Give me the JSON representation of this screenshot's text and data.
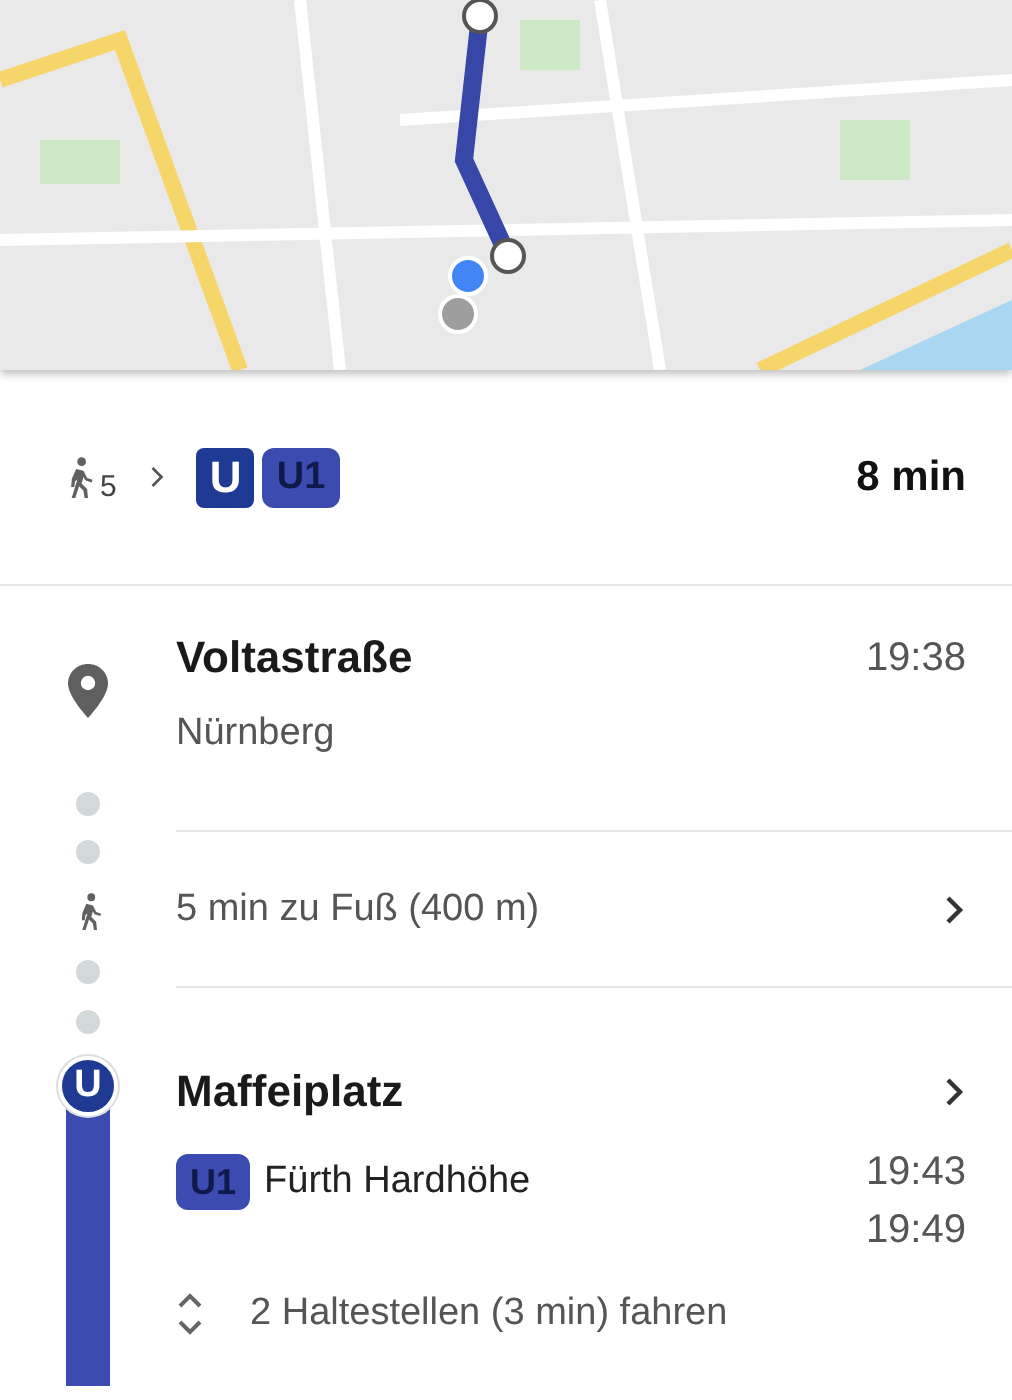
{
  "summary": {
    "walk_minutes": "5",
    "system_badge": "U",
    "line": "U1",
    "duration": "8 min"
  },
  "steps": [
    {
      "kind": "place",
      "name": "Voltastraße",
      "city": "Nürnberg",
      "time": "19:38"
    },
    {
      "kind": "walk",
      "text": "5 min zu Fuß (400 m)"
    },
    {
      "kind": "transit",
      "station": "Maffeiplatz",
      "station_badge": "U",
      "line": "U1",
      "headsign": "Fürth Hardhöhe",
      "times": [
        "19:43",
        "19:49"
      ],
      "stops": "2 Haltestellen (3 min) fahren"
    }
  ]
}
